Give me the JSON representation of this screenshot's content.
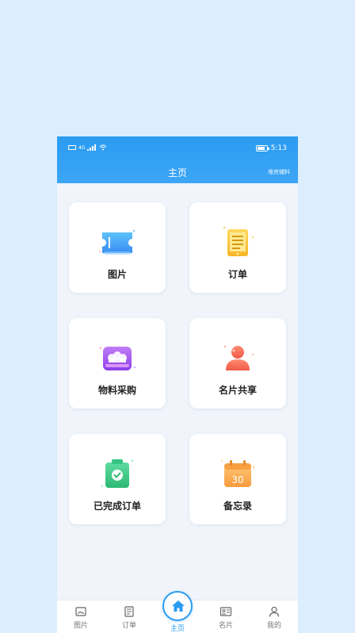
{
  "status_bar": {
    "network": "4G",
    "time": "5:13"
  },
  "header": {
    "title": "主页",
    "right_link": "堆房辅料"
  },
  "cards": [
    {
      "label": "图片",
      "icon": "ticket-icon"
    },
    {
      "label": "订单",
      "icon": "tablet-list-icon"
    },
    {
      "label": "物料采购",
      "icon": "cart-box-icon"
    },
    {
      "label": "名片共享",
      "icon": "user-icon"
    },
    {
      "label": "已完成订单",
      "icon": "clipboard-check-icon"
    },
    {
      "label": "备忘录",
      "icon": "calendar-icon"
    }
  ],
  "calendar_day": "30",
  "tabs": [
    {
      "label": "图片",
      "icon": "image-icon"
    },
    {
      "label": "订单",
      "icon": "document-icon"
    },
    {
      "label": "主页",
      "icon": "home-icon",
      "active": true
    },
    {
      "label": "名片",
      "icon": "id-card-icon"
    },
    {
      "label": "我的",
      "icon": "person-icon"
    }
  ],
  "colors": {
    "primary": "#2b9cf2",
    "page_bg": "#dceefd",
    "card_bg": "#ffffff"
  }
}
